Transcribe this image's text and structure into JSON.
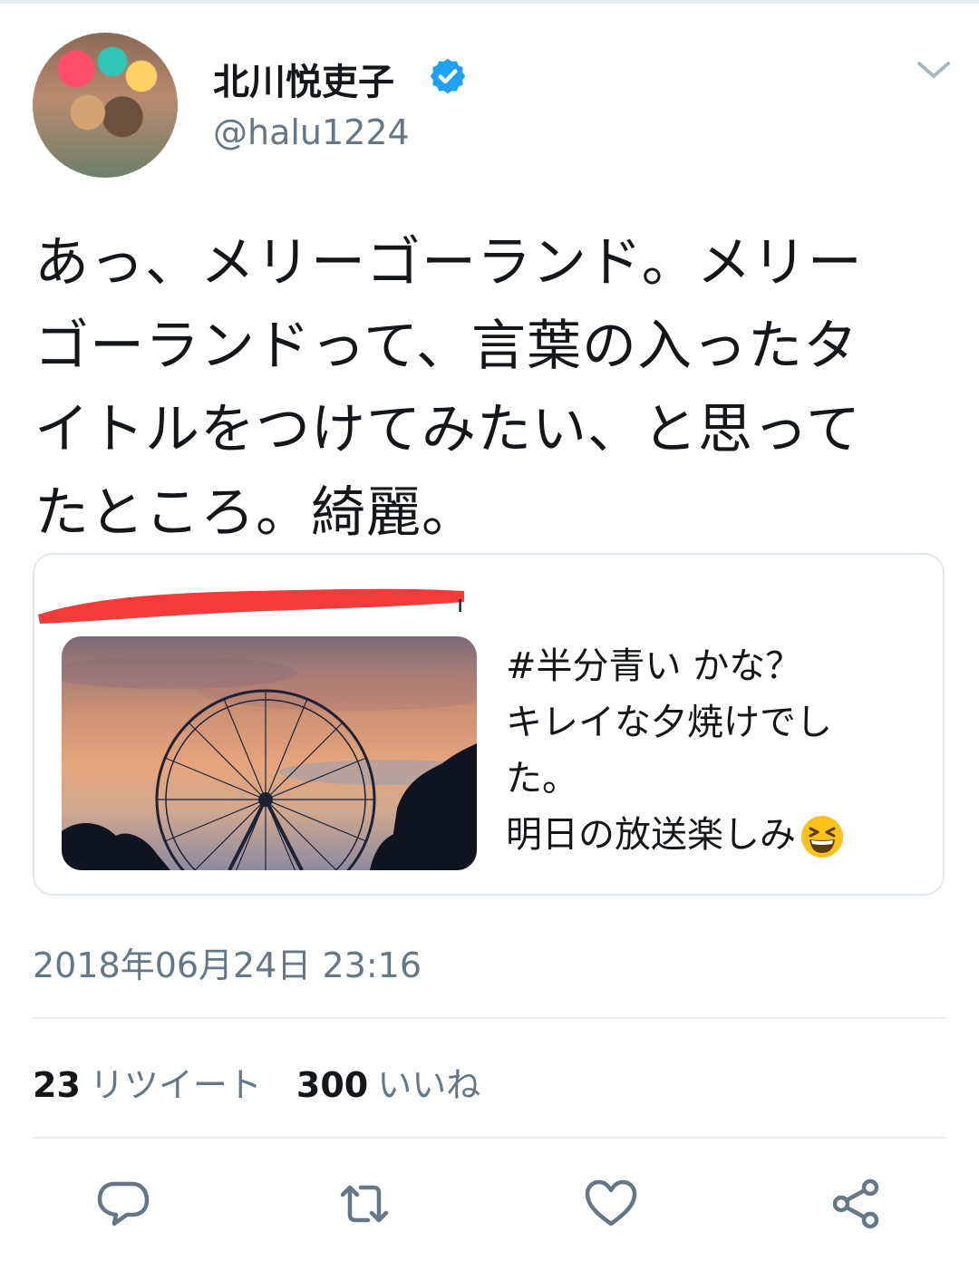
{
  "user": {
    "display_name": "北川悦吏子",
    "handle": "@halu1224"
  },
  "icons": {
    "verified": "verified-badge-icon",
    "more": "chevron-down-icon",
    "reply": "reply-icon",
    "retweet": "retweet-icon",
    "like": "heart-icon",
    "share": "share-icon",
    "emoji": "grinning-squinting-face-emoji"
  },
  "colors": {
    "verified": "#1da1f2",
    "secondary_text": "#657786",
    "redaction": "#f23b3b"
  },
  "tweet": {
    "lines": [
      "あっ、メリーゴーランド。メリー",
      "ゴーランドって、言葉の入ったタ",
      "イトルをつけてみたい、と思って",
      "たところ。綺麗。"
    ],
    "timestamp": "2018年06月24日 23:16"
  },
  "quoted": {
    "author_mark": "ı",
    "image_alt": "夕焼けの観覧車",
    "lines": [
      "#半分青い かな？",
      "キレイな夕焼けでし",
      "た。",
      "明日の放送楽しみ"
    ]
  },
  "stats": {
    "retweets_count": "23",
    "retweets_label": "リツイート",
    "likes_count": "300",
    "likes_label": "いいね"
  }
}
